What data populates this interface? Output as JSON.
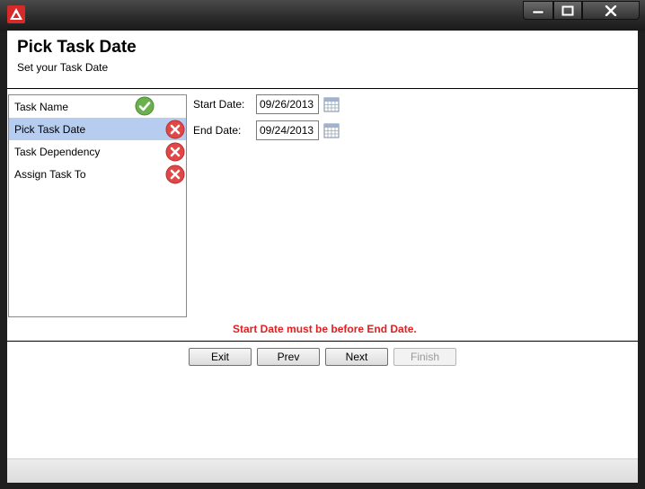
{
  "window": {
    "header_title": "Pick Task Date",
    "header_subtitle": "Set your Task Date"
  },
  "steps": [
    {
      "label": "Task Name",
      "status": "complete"
    },
    {
      "label": "Pick Task Date",
      "status": "error",
      "selected": true
    },
    {
      "label": "Task Dependency",
      "status": "error"
    },
    {
      "label": "Assign Task To",
      "status": "error"
    }
  ],
  "form": {
    "start_label": "Start Date:",
    "start_value": "09/26/2013",
    "end_label": "End Date:",
    "end_value": "09/24/2013"
  },
  "error_message": "Start Date must be before End Date.",
  "buttons": {
    "exit": "Exit",
    "prev": "Prev",
    "next": "Next",
    "finish": "Finish"
  },
  "colors": {
    "selected_row": "#b6cdf0",
    "error_text": "#e02020",
    "check_green": "#6ab04c",
    "error_red": "#e04848"
  }
}
